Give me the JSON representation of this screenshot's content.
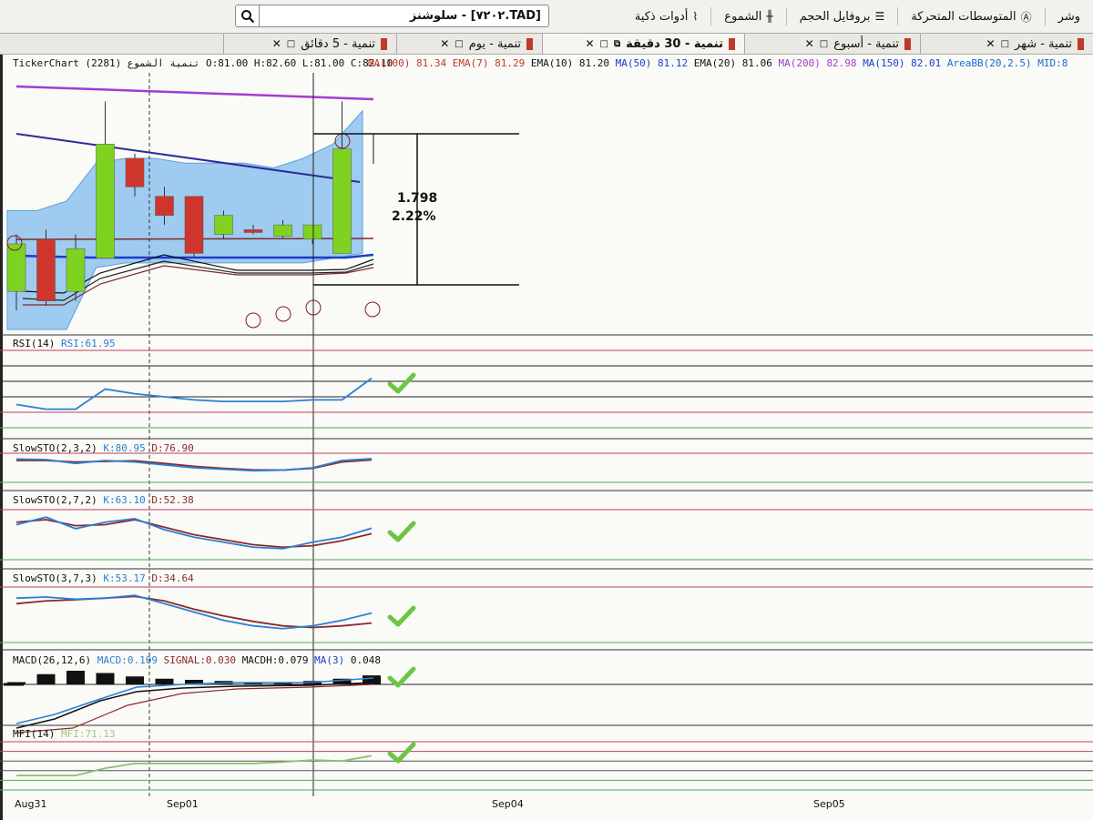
{
  "toolbar": {
    "items": [
      {
        "label": "وشر",
        "icon": "toolbar-icon"
      },
      {
        "label": "المتوسطات المتحركة",
        "icon": "moving-averages-icon"
      },
      {
        "label": "بروفايل الحجم",
        "icon": "volume-profile-icon"
      },
      {
        "label": "الشموع",
        "icon": "candles-icon"
      },
      {
        "label": "أدوات ذكية",
        "icon": "smart-tools-icon"
      }
    ],
    "search_value": "[TAD.٧٢٠٢] - سلوشنز"
  },
  "tabs": [
    {
      "label": "تنمية - شهر"
    },
    {
      "label": "تنمية - أسبوع"
    },
    {
      "label": "تنمية - 30 دقيقة"
    },
    {
      "label": "تنمية - يوم"
    },
    {
      "label": "تنمية - 5 دقائق"
    }
  ],
  "main_header": {
    "title": "TickerChart تنمية الشموع (2281) O:81.00 H:82.60 L:81.00 C:82.10",
    "indicators": [
      {
        "name": "MA(100)",
        "value": "81.34",
        "color": "#c0392b"
      },
      {
        "name": "EMA(7)",
        "value": "81.29",
        "color": "#c0392b"
      },
      {
        "name": "EMA(10)",
        "value": "81.20",
        "color": "#111111"
      },
      {
        "name": "MA(50)",
        "value": "81.12",
        "color": "#1a3ccf"
      },
      {
        "name": "EMA(20)",
        "value": "81.06",
        "color": "#111111"
      },
      {
        "name": "MA(200)",
        "value": "82.98",
        "color": "#a33ccf"
      },
      {
        "name": "MA(150)",
        "value": "82.01",
        "color": "#1a3ccf"
      },
      {
        "name": "AreaBB(20,2.5)",
        "value": "MID:8",
        "color": "#1a6ad0"
      }
    ]
  },
  "measure": {
    "change": "1.798",
    "percent": "2.22%"
  },
  "panels": {
    "rsi": {
      "label": "RSI(14)",
      "value": "RSI:61.95"
    },
    "sto1": {
      "label": "SlowSTO(2,3,2)",
      "k": "K:80.95",
      "d": "D:76.90"
    },
    "sto2": {
      "label": "SlowSTO(2,7,2)",
      "k": "K:63.10",
      "d": "D:52.38"
    },
    "sto3": {
      "label": "SlowSTO(3,7,3)",
      "k": "K:53.17",
      "d": "D:34.64"
    },
    "macd": {
      "label": "MACD(26,12,6)",
      "macd": "MACD:0.109",
      "signal": "SIGNAL:0.030",
      "macdh": "MACDH:0.079",
      "ma": "MA(3)",
      "ma_val": "0.048"
    },
    "mfi": {
      "label": "MFI(14)",
      "value": "MFI:71.13"
    }
  },
  "dates": [
    "Aug31",
    "Sep01",
    "Sep04",
    "Sep05"
  ],
  "colors": {
    "up": "#7ed321",
    "down": "#d0352b",
    "band": "#9ecbef",
    "check": "#6cc644",
    "ma200": "#a33ccf",
    "ma50": "#2b2a9e",
    "rsi": "#2a7fd4",
    "d_line": "#8b2a2a"
  },
  "chart_data": {
    "type": "candlestick",
    "ohlc": [
      {
        "o": 80.6,
        "h": 81.2,
        "l": 80.4,
        "c": 81.1
      },
      {
        "o": 81.15,
        "h": 81.25,
        "l": 80.45,
        "c": 80.5
      },
      {
        "o": 80.6,
        "h": 81.2,
        "l": 80.5,
        "c": 81.05
      },
      {
        "o": 80.95,
        "h": 82.6,
        "l": 80.95,
        "c": 82.15
      },
      {
        "o": 82.0,
        "h": 82.05,
        "l": 81.6,
        "c": 81.7
      },
      {
        "o": 81.6,
        "h": 81.7,
        "l": 81.3,
        "c": 81.4
      },
      {
        "o": 81.6,
        "h": 81.6,
        "l": 80.95,
        "c": 81.0
      },
      {
        "o": 81.2,
        "h": 81.45,
        "l": 81.15,
        "c": 81.4
      },
      {
        "o": 81.25,
        "h": 81.3,
        "l": 81.2,
        "c": 81.22
      },
      {
        "o": 81.18,
        "h": 81.35,
        "l": 81.15,
        "c": 81.3
      },
      {
        "o": 81.15,
        "h": 81.25,
        "l": 81.1,
        "c": 81.3
      },
      {
        "o": 81.0,
        "h": 82.6,
        "l": 81.0,
        "c": 82.1
      }
    ],
    "rsi": [
      45,
      42,
      42,
      55,
      52,
      50,
      48,
      47,
      47,
      47,
      48,
      48,
      62
    ],
    "sto_fast": [
      [
        80,
        78,
        65,
        75,
        70,
        60,
        50,
        45,
        40,
        42,
        50,
        75,
        81
      ],
      [
        70,
        85,
        62,
        75,
        82,
        60,
        45,
        35,
        25,
        22,
        35,
        45,
        63
      ],
      [
        80,
        82,
        78,
        80,
        85,
        70,
        55,
        40,
        30,
        25,
        30,
        40,
        53
      ]
    ],
    "sto_slow": [
      [
        75,
        75,
        70,
        72,
        74,
        65,
        55,
        48,
        43,
        42,
        48,
        70,
        77
      ],
      [
        75,
        80,
        68,
        70,
        80,
        65,
        50,
        40,
        30,
        25,
        28,
        38,
        52
      ],
      [
        70,
        75,
        77,
        80,
        83,
        75,
        60,
        48,
        38,
        30,
        27,
        30,
        35
      ]
    ],
    "macd_hist": [
      0.02,
      0.09,
      0.12,
      0.1,
      0.07,
      0.05,
      0.04,
      0.03,
      0.02,
      0.02,
      0.03,
      0.05,
      0.079
    ],
    "mfi": [
      30,
      30,
      30,
      45,
      55,
      55,
      55,
      55,
      55,
      58,
      62,
      60,
      71
    ]
  }
}
